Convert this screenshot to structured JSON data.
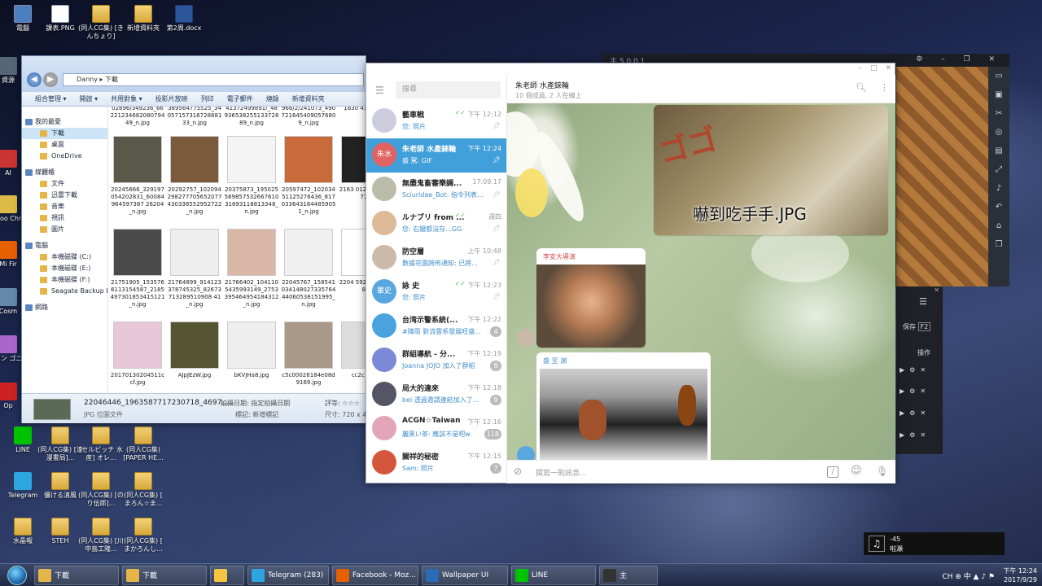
{
  "desktop": {
    "top_icons": [
      {
        "label": "電腦"
      },
      {
        "label": "課表.PNG"
      },
      {
        "label": "(同人CG集) [きんちょり]"
      },
      {
        "label": "新增資料夾"
      },
      {
        "label": "第2周.docx"
      }
    ],
    "left_icons": [
      {
        "label": "資源"
      },
      {
        "label": "AI"
      },
      {
        "label": "Goo Chr"
      },
      {
        "label": "Mi Fir"
      },
      {
        "label": "Cosm"
      },
      {
        "label": "パン ゴニ"
      },
      {
        "label": "Op"
      }
    ],
    "bottom_icons": [
      {
        "label": "LINE"
      },
      {
        "label": "(同人CG集) [浪漫書局]..."
      },
      {
        "label": "[セルビッチ 水産] オレ..."
      },
      {
        "label": "(同人CG集) [PAPER HE..."
      },
      {
        "label": "Telegram"
      },
      {
        "label": "僵ける滇風"
      },
      {
        "label": "(同人CG集) [のり伍郎]..."
      },
      {
        "label": "(同人CG集) [ まろん☆ま..."
      },
      {
        "label": "水晶報"
      },
      {
        "label": "STEH"
      },
      {
        "label": "(同人CG集) [川中島工隆..."
      },
      {
        "label": "(同人CG集) [ まかろんし..."
      }
    ]
  },
  "explorer": {
    "breadcrumb": "Danny ▸ 下載",
    "toolbar": [
      "組合管理 ▾",
      "開啟 ▾",
      "共用對象 ▾",
      "投影片放映",
      "列印",
      "電子郵件",
      "燒錄",
      "新增資料夾"
    ],
    "sidebar": [
      {
        "label": "我的最愛",
        "kind": "h"
      },
      {
        "label": "下載",
        "kind": "sel"
      },
      {
        "label": "桌面",
        "kind": ""
      },
      {
        "label": "OneDrive",
        "kind": ""
      },
      {
        "label": "媒體櫃",
        "kind": "h"
      },
      {
        "label": "文件",
        "kind": ""
      },
      {
        "label": "迅雷下載",
        "kind": ""
      },
      {
        "label": "音樂",
        "kind": ""
      },
      {
        "label": "視訊",
        "kind": ""
      },
      {
        "label": "圖片",
        "kind": ""
      },
      {
        "label": "電腦",
        "kind": "h"
      },
      {
        "label": "本機磁碟 (C:)",
        "kind": ""
      },
      {
        "label": "本機磁碟 (E:)",
        "kind": ""
      },
      {
        "label": "本機磁碟 (F:)",
        "kind": ""
      },
      {
        "label": "Seagate Backup Pl",
        "kind": ""
      },
      {
        "label": "網路",
        "kind": "h"
      }
    ],
    "top_row": [
      "02896/349236_6622123468208079449_n.jpg",
      "389564775525_3405715731672888133_n.jpg",
      "41372499891/_4893653825513372889_n.jpg",
      "966/2/241073_4907216454090576809_n.jpg",
      "1830 4397 151"
    ],
    "files": [
      {
        "name": "20245666_329197054202831_60084964597387 26204_n.jpg",
        "color": "#5b5a4a"
      },
      {
        "name": "20292757_102094298277705652077430338552952722_n.jpg",
        "color": "#7a5a3a"
      },
      {
        "name": "20375873_19502558985753266761031693118813348_n.jpg",
        "color": "#f4f4f4"
      },
      {
        "name": "20597472_10203451125276436_8170336431844859051_n.jpg",
        "color": "#c96a3a"
      },
      {
        "name": "2163 0129 1657 1776",
        "color": "#222"
      },
      {
        "name": "21751905_1535766113154587_2185497301853415121_n.jpg",
        "color": "#4a4a4a"
      },
      {
        "name": "21764899_914123378745325_82673713289510908 41_n.jpg",
        "color": "#eee"
      },
      {
        "name": "21766402_1041105435993149_2753395464954184312_n.jpg",
        "color": "#d8b7a6"
      },
      {
        "name": "22045767_15854103414802733576444060538151995_n.jpg",
        "color": "#f0f0f0"
      },
      {
        "name": "2204 5925 4147 987",
        "color": "#fff"
      },
      {
        "name": "20170130204511ccf.jpg",
        "color": "#e8c8d8"
      },
      {
        "name": "AJpJEzW.jpg",
        "color": "#553"
      },
      {
        "name": "bKVJHa8.jpg",
        "color": "#eee"
      },
      {
        "name": "c5c00026184e08d9169.jpg",
        "color": "#a98"
      },
      {
        "name": "cc2c 064(",
        "color": "#ddd"
      }
    ],
    "footer": {
      "name": "22046446_1963587717230718_4697...",
      "type": "JPG 位圖文件",
      "taken_label": "拍攝日期:",
      "taken_value": "指定拍攝日期",
      "tag_label": "標記:",
      "tag_value": "新增標記",
      "rating_label": "評等:",
      "size_label": "尺寸: 720 x 4"
    }
  },
  "telegram": {
    "search_placeholder": "搜尋",
    "chats": [
      {
        "name": "藝車戦",
        "time": "下午 12:12",
        "last": "您: 照片",
        "avatar": "#ccd",
        "badge": "",
        "pin": true,
        "check": true
      },
      {
        "name": "朱老師 水產錸輪",
        "time": "下午 12:24",
        "last": "盛 駕: GIF",
        "avatar": "#e06262",
        "avatar_text": "朱水",
        "badge": "",
        "pin": true,
        "selected": true
      },
      {
        "name": "無盡鬼畜審樂調...",
        "time": "17.09.17",
        "last": "Sciuridae_Bot: 指令列表...",
        "avatar": "#bba",
        "badge": "",
        "pin": true
      },
      {
        "name": "ルナブリ from ...",
        "time": "週四",
        "last": "您: 右鍵都沒存...GG",
        "avatar": "#db9",
        "badge": "",
        "pin": true,
        "check": true
      },
      {
        "name": "防空層",
        "time": "上午 10:48",
        "last": "數據花園跨佈通知: 已將...",
        "avatar": "#cba",
        "badge": "",
        "pin": true
      },
      {
        "name": "詠 史",
        "time": "下午 12:23",
        "last": "您: 照片",
        "avatar": "#5aa7e0",
        "avatar_text": "華史",
        "badge": "",
        "pin": true,
        "check": true
      },
      {
        "name": "台湾示警系統(...",
        "time": "下午 12:22",
        "last": "#陣雨 對流雲系發展旺盛...",
        "avatar": "#4aa3df",
        "badge": "4"
      },
      {
        "name": "群組導航 - 分...",
        "time": "下午 12:19",
        "last": "Joanna JOJO 加入了群組",
        "avatar": "#7b8ad6",
        "badge": "8"
      },
      {
        "name": "局大的違來",
        "time": "下午 12:18",
        "last": "bei 透過邀請連結加入了...",
        "avatar": "#556",
        "badge": "9"
      },
      {
        "name": "ACGN☆Taiwan",
        "time": "下午 12:16",
        "last": "麗黑い茶: 應該不是吧w",
        "avatar": "#e2a6b8",
        "badge": "118"
      },
      {
        "name": "關祥的秘密",
        "time": "下午 12:15",
        "last": "Sam: 照片",
        "avatar": "#d5573b",
        "badge": "7"
      },
      {
        "name": "琉球上游來來...",
        "time": "下午 12:14",
        "last": "",
        "avatar": "#888",
        "badge": ""
      }
    ],
    "header": {
      "title": "朱老師 水產錸輪",
      "subtitle": "10 個成員, 2 人在線上"
    },
    "image_caption": "嚇到吃手手.JPG",
    "msg1_sender": "李安大導演",
    "msg2_sender": "盛 至 渊",
    "input_placeholder": "撰寫一則訊息..."
  },
  "nox": {
    "title": "主 5.0.0.1",
    "panel_label1": "保存",
    "panel_key": "F2",
    "panel_label2": "操作"
  },
  "music": {
    "time": "-45",
    "title": "啦瀬"
  },
  "taskbar": {
    "items": [
      {
        "label": "下載",
        "color": "#e5b54a"
      },
      {
        "label": "下載",
        "color": "#e5b54a"
      },
      {
        "label": "",
        "color": "#f5c542"
      },
      {
        "label": "Telegram (283)",
        "color": "#2ca5e0"
      },
      {
        "label": "Facebook - Moz...",
        "color": "#e66000"
      },
      {
        "label": "Wallpaper UI",
        "color": "#2b6ab5"
      },
      {
        "label": "LINE",
        "color": "#00c300"
      },
      {
        "label": "主",
        "color": "#333"
      }
    ],
    "time": "下午 12:24",
    "date": "2017/9/29",
    "lang": "CH ⊕ 中"
  }
}
